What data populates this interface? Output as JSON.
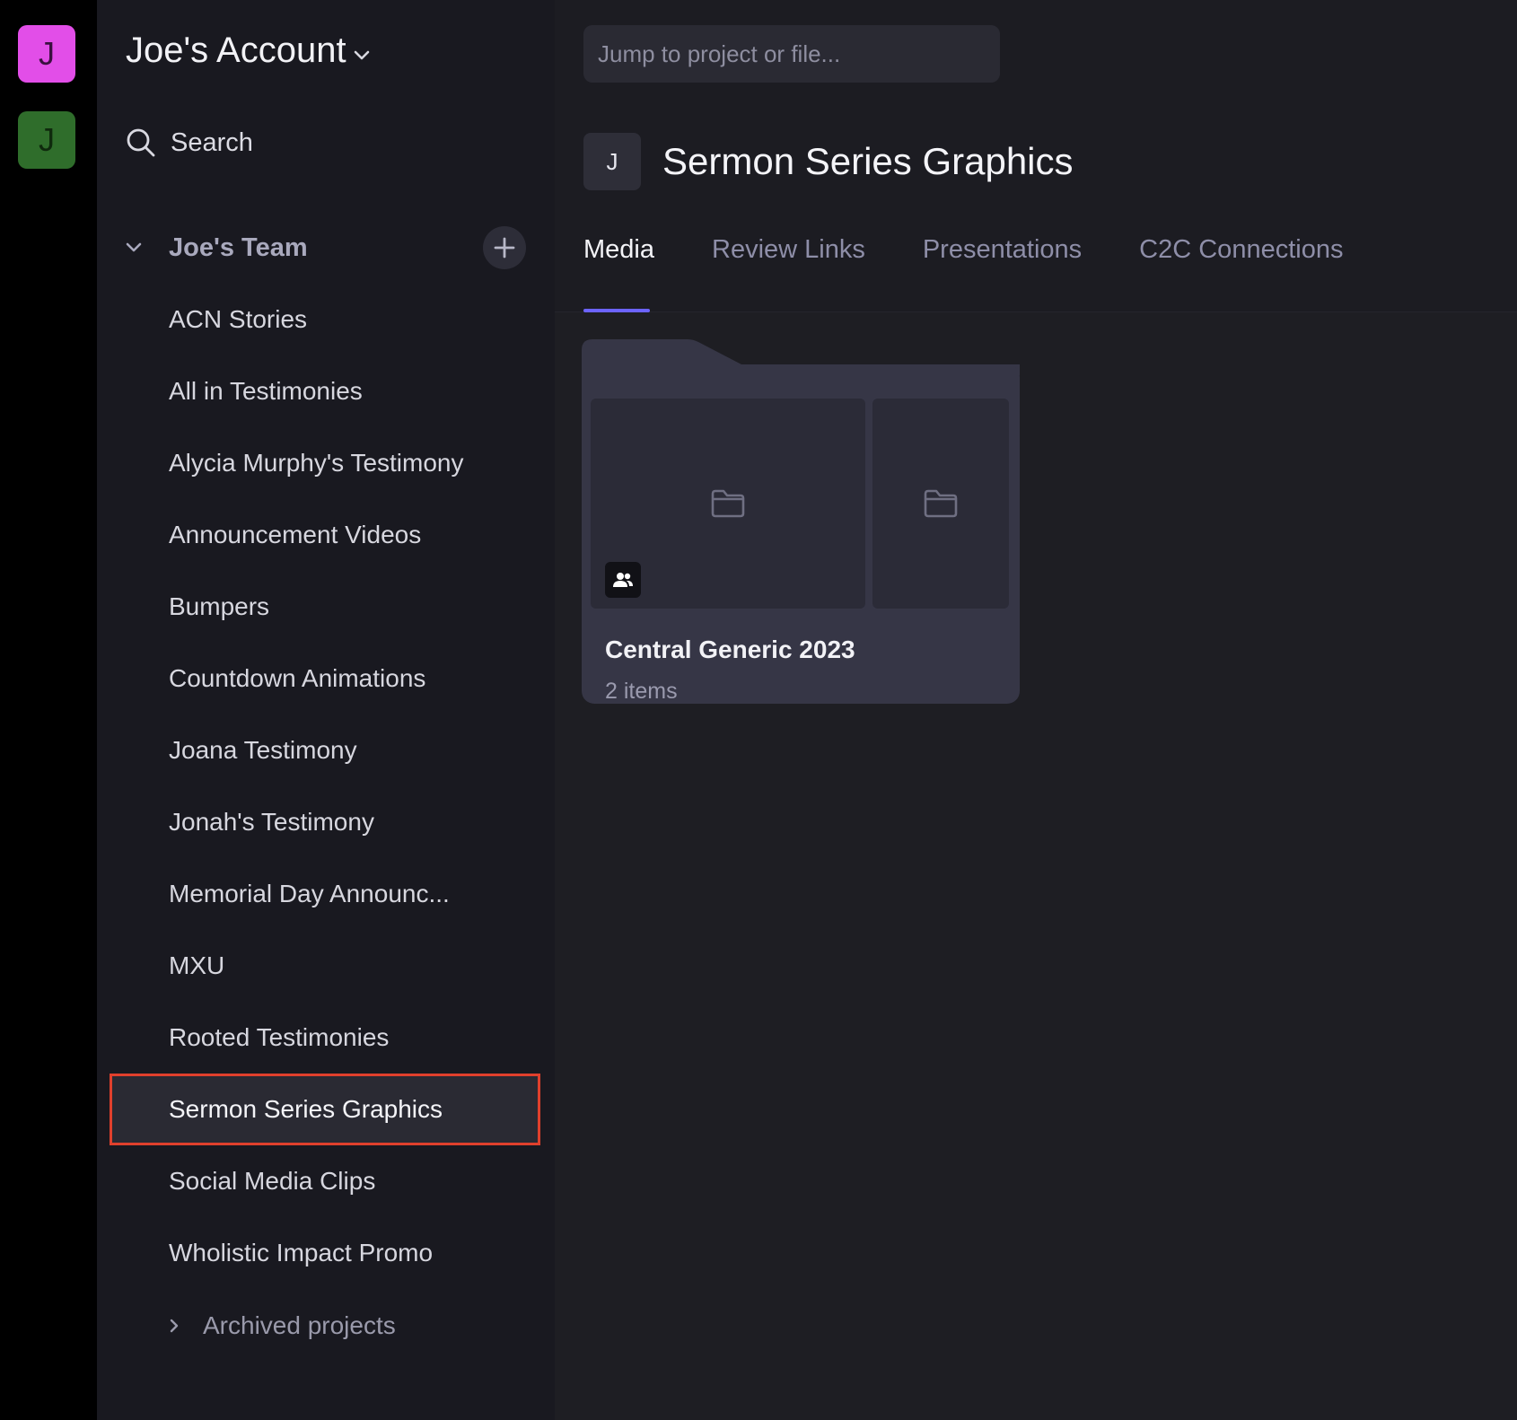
{
  "rail": {
    "accounts": [
      {
        "initial": "J",
        "color": "#e24ee8"
      },
      {
        "initial": "J",
        "color": "#2f6d2b"
      }
    ]
  },
  "sidebar": {
    "account_name": "Joe's Account",
    "search_label": "Search",
    "team": {
      "name": "Joe's Team"
    },
    "projects": [
      {
        "label": "ACN Stories"
      },
      {
        "label": "All in Testimonies"
      },
      {
        "label": "Alycia Murphy's Testimony"
      },
      {
        "label": "Announcement Videos"
      },
      {
        "label": "Bumpers"
      },
      {
        "label": "Countdown Animations"
      },
      {
        "label": "Joana Testimony"
      },
      {
        "label": "Jonah's Testimony"
      },
      {
        "label": "Memorial Day Announc..."
      },
      {
        "label": "MXU"
      },
      {
        "label": "Rooted Testimonies"
      },
      {
        "label": "Sermon Series Graphics",
        "active": true
      },
      {
        "label": "Social Media Clips"
      },
      {
        "label": "Wholistic Impact Promo"
      }
    ],
    "archived_label": "Archived projects"
  },
  "header": {
    "jump_placeholder": "Jump to project or file...",
    "project_initial": "J",
    "project_title": "Sermon Series Graphics",
    "tabs": [
      {
        "label": "Media",
        "active": true
      },
      {
        "label": "Review Links"
      },
      {
        "label": "Presentations"
      },
      {
        "label": "C2C Connections"
      }
    ]
  },
  "content": {
    "folders": [
      {
        "name": "Central Generic 2023",
        "count": "2 items",
        "shared": true
      }
    ]
  },
  "colors": {
    "accent": "#6c63ff",
    "selection_outline": "#e0402c"
  }
}
